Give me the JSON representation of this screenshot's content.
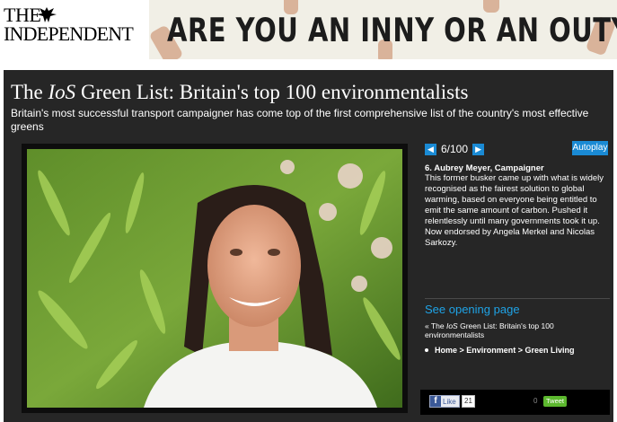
{
  "header": {
    "logo_line1": "THE",
    "logo_line2": "INDEPENDENT",
    "banner_text": "ARE YOU AN INNY OR AN OUTY?"
  },
  "article": {
    "title_prefix": "The ",
    "title_italic": "IoS",
    "title_suffix": " Green List: Britain's top 100 environmentalists",
    "subtitle": "Britain's most successful transport campaigner has come top of the first comprehensive list of the country's most effective greens"
  },
  "gallery": {
    "prev_icon": "arrow-left-icon",
    "next_icon": "arrow-right-icon",
    "counter": "6/100",
    "autoplay_label": "Autoplay",
    "person": "6. Aubrey Meyer, Campaigner",
    "description": "This former busker came up with what is widely recognised as the fairest solution to global warming, based on everyone being entitled to emit the same amount of carbon. Pushed it relentlessly until many governments took it up. Now endorsed by Angela Merkel and Nicolas Sarkozy.",
    "see_link": "See opening page",
    "back_prefix": "« The ",
    "back_italic": "IoS",
    "back_suffix": " Green List: Britain's top 100 environmentalists",
    "breadcrumb": "Home > Environment > Green Living"
  },
  "social": {
    "like_label": "Like",
    "like_count": "21",
    "tweet_count": "0",
    "tweet_label": "Tweet"
  },
  "colors": {
    "panel": "#262626",
    "accent": "#1a8ad4",
    "link": "#1fa3e6"
  }
}
